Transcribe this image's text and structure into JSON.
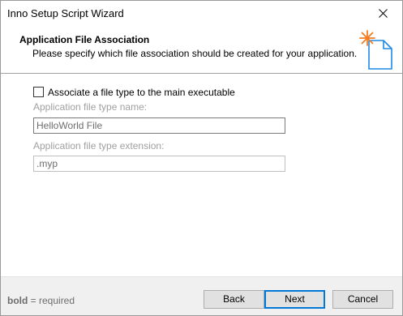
{
  "window": {
    "title": "Inno Setup Script Wizard"
  },
  "header": {
    "title": "Application File Association",
    "subtitle": "Please specify which file association should be created for your application."
  },
  "form": {
    "checkbox_label": "Associate a file type to the main executable",
    "checkbox_checked": false,
    "type_name_label": "Application file type name:",
    "type_name_value": "HelloWorld File",
    "type_ext_label": "Application file type extension:",
    "type_ext_value": ".myp"
  },
  "footer": {
    "note_bold": "bold",
    "note_rest": " = required",
    "back_label": "Back",
    "next_label": "Next",
    "cancel_label": "Cancel"
  },
  "colors": {
    "accent": "#0078d7",
    "disabled_text": "#a0a0a0",
    "icon_star": "#f47c20",
    "icon_page": "#1e88e5"
  }
}
